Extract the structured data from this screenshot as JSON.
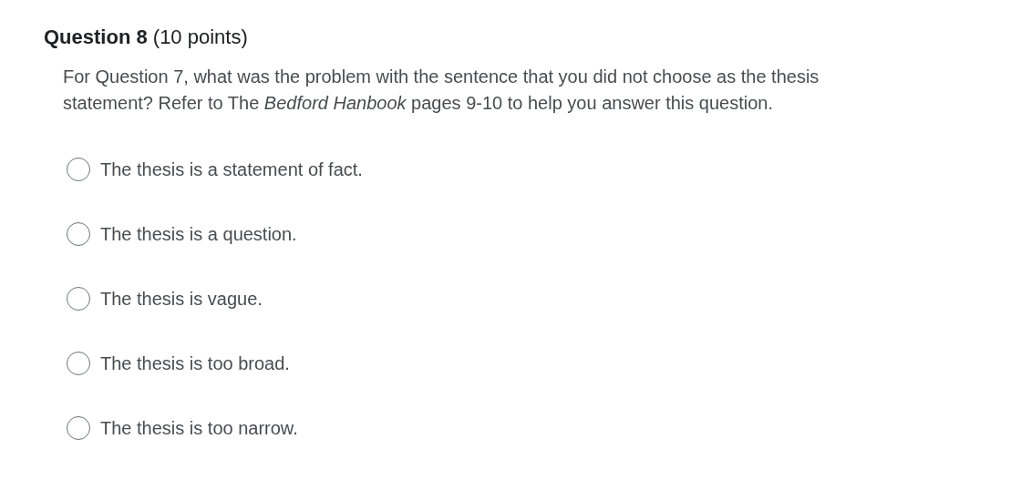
{
  "question": {
    "title": "**Question 8** (10 points)",
    "prompt": "For Question 7, what was the problem with the sentence that you did not choose as the thesis statement? Refer to The *Bedford Hanbook* pages 9-10 to help you answer this question."
  },
  "options": [
    {
      "label": "The thesis is a statement of fact.",
      "selected": false
    },
    {
      "label": "The thesis is a question.",
      "selected": false
    },
    {
      "label": "The thesis is vague.",
      "selected": false
    },
    {
      "label": "The thesis is too broad.",
      "selected": false
    },
    {
      "label": "The thesis is too narrow.",
      "selected": false
    }
  ]
}
